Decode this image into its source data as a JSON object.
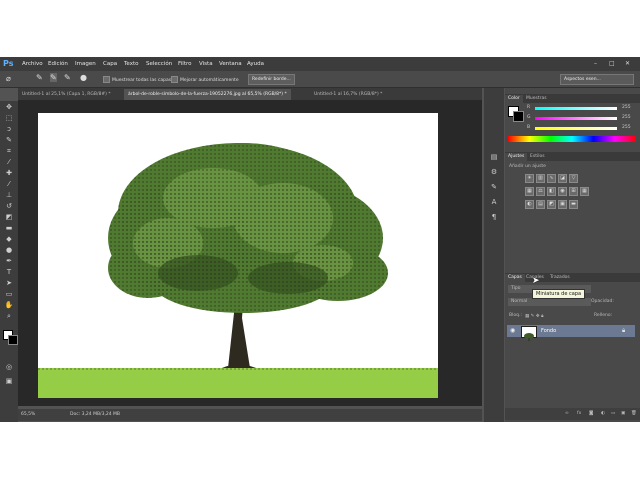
{
  "app": {
    "logo": "Ps"
  },
  "menu": [
    "Archivo",
    "Edición",
    "Imagen",
    "Capa",
    "Texto",
    "Selección",
    "Filtro",
    "Vista",
    "Ventana",
    "Ayuda"
  ],
  "options": {
    "sample_all": "Muestrear todas las capas",
    "auto_enhance": "Mejorar automáticamente",
    "refine_edge": "Redefinir borde...",
    "workspace": "Aspectos esen..."
  },
  "tabs": [
    {
      "label": "Untitled-1 al 25,1% (Capa 1, RGB/8#) *"
    },
    {
      "label": "árbol-de-roble-símbolo-de-la-fuerza-19052276.jpg al 65,5% (RGB/8*) *"
    },
    {
      "label": "Untitled-1 al 16,7% (RGB/8*) *"
    }
  ],
  "status": {
    "zoom": "65,5%",
    "doc": "Doc: 3,24 MB/3,24 MB"
  },
  "color_panel": {
    "tabs": [
      "Color",
      "Muestras"
    ],
    "rows": [
      {
        "label": "R",
        "value": "255"
      },
      {
        "label": "G",
        "value": "255"
      },
      {
        "label": "B",
        "value": "255"
      }
    ]
  },
  "adjust_panel": {
    "tabs": [
      "Ajustes",
      "Estilos"
    ],
    "heading": "Añadir un ajuste"
  },
  "layers_panel": {
    "tabs": [
      "Capas",
      "Canales",
      "Trazados"
    ],
    "kind": "Tipo",
    "blend": "Normal",
    "opacity_label": "Opacidad:",
    "lock_label": "Bloq.:",
    "fill_label": "Relleno:",
    "layer_name": "Fondo"
  },
  "tooltip": "Miniatura de capa",
  "colors": {
    "accent": "#5eb1ff",
    "grass": "#8dc63f",
    "layer_selected": "#6b7a92"
  }
}
